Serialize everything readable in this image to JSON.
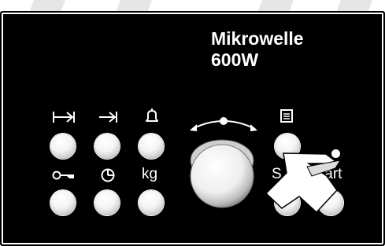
{
  "appliance": {
    "title_line1": "Mikrowelle",
    "title_line2": "600W"
  },
  "buttons": {
    "row1": [
      {
        "id": "skip-end",
        "icon": "skip-to-end-icon"
      },
      {
        "id": "skip-next",
        "icon": "arrow-to-bar-icon"
      },
      {
        "id": "alarm",
        "icon": "bell-icon"
      },
      {
        "id": "memory",
        "icon": "memory-layers-icon"
      }
    ],
    "row2": [
      {
        "id": "child-lock",
        "icon": "key-icon"
      },
      {
        "id": "timer",
        "icon": "clock-icon"
      },
      {
        "id": "weight",
        "label": "kg"
      },
      {
        "id": "stop",
        "label": "S"
      },
      {
        "id": "start",
        "label": "tart"
      }
    ]
  },
  "colors": {
    "panel": "#000000",
    "foreground": "#ffffff"
  }
}
